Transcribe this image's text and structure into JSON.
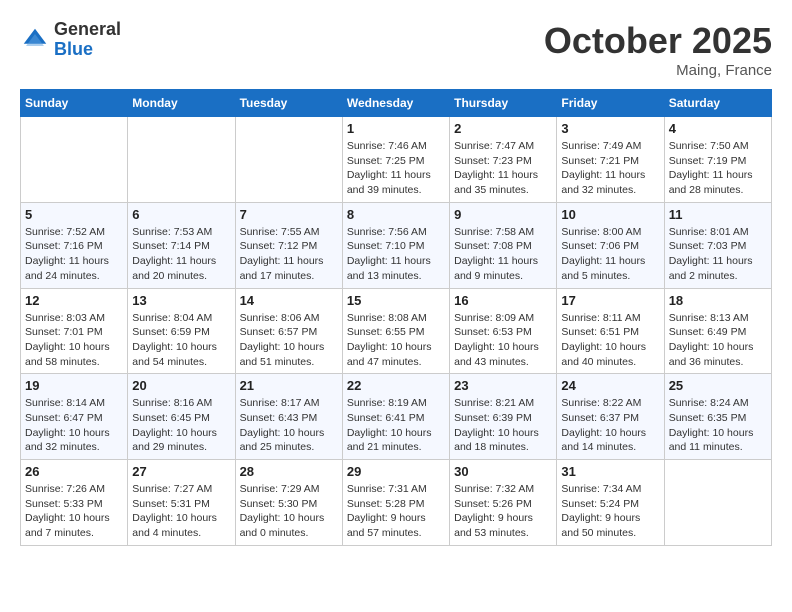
{
  "header": {
    "logo_general": "General",
    "logo_blue": "Blue",
    "month_title": "October 2025",
    "location": "Maing, France"
  },
  "days_of_week": [
    "Sunday",
    "Monday",
    "Tuesday",
    "Wednesday",
    "Thursday",
    "Friday",
    "Saturday"
  ],
  "weeks": [
    [
      {
        "day": "",
        "info": ""
      },
      {
        "day": "",
        "info": ""
      },
      {
        "day": "",
        "info": ""
      },
      {
        "day": "1",
        "sunrise": "Sunrise: 7:46 AM",
        "sunset": "Sunset: 7:25 PM",
        "daylight": "Daylight: 11 hours and 39 minutes."
      },
      {
        "day": "2",
        "sunrise": "Sunrise: 7:47 AM",
        "sunset": "Sunset: 7:23 PM",
        "daylight": "Daylight: 11 hours and 35 minutes."
      },
      {
        "day": "3",
        "sunrise": "Sunrise: 7:49 AM",
        "sunset": "Sunset: 7:21 PM",
        "daylight": "Daylight: 11 hours and 32 minutes."
      },
      {
        "day": "4",
        "sunrise": "Sunrise: 7:50 AM",
        "sunset": "Sunset: 7:19 PM",
        "daylight": "Daylight: 11 hours and 28 minutes."
      }
    ],
    [
      {
        "day": "5",
        "sunrise": "Sunrise: 7:52 AM",
        "sunset": "Sunset: 7:16 PM",
        "daylight": "Daylight: 11 hours and 24 minutes."
      },
      {
        "day": "6",
        "sunrise": "Sunrise: 7:53 AM",
        "sunset": "Sunset: 7:14 PM",
        "daylight": "Daylight: 11 hours and 20 minutes."
      },
      {
        "day": "7",
        "sunrise": "Sunrise: 7:55 AM",
        "sunset": "Sunset: 7:12 PM",
        "daylight": "Daylight: 11 hours and 17 minutes."
      },
      {
        "day": "8",
        "sunrise": "Sunrise: 7:56 AM",
        "sunset": "Sunset: 7:10 PM",
        "daylight": "Daylight: 11 hours and 13 minutes."
      },
      {
        "day": "9",
        "sunrise": "Sunrise: 7:58 AM",
        "sunset": "Sunset: 7:08 PM",
        "daylight": "Daylight: 11 hours and 9 minutes."
      },
      {
        "day": "10",
        "sunrise": "Sunrise: 8:00 AM",
        "sunset": "Sunset: 7:06 PM",
        "daylight": "Daylight: 11 hours and 5 minutes."
      },
      {
        "day": "11",
        "sunrise": "Sunrise: 8:01 AM",
        "sunset": "Sunset: 7:03 PM",
        "daylight": "Daylight: 11 hours and 2 minutes."
      }
    ],
    [
      {
        "day": "12",
        "sunrise": "Sunrise: 8:03 AM",
        "sunset": "Sunset: 7:01 PM",
        "daylight": "Daylight: 10 hours and 58 minutes."
      },
      {
        "day": "13",
        "sunrise": "Sunrise: 8:04 AM",
        "sunset": "Sunset: 6:59 PM",
        "daylight": "Daylight: 10 hours and 54 minutes."
      },
      {
        "day": "14",
        "sunrise": "Sunrise: 8:06 AM",
        "sunset": "Sunset: 6:57 PM",
        "daylight": "Daylight: 10 hours and 51 minutes."
      },
      {
        "day": "15",
        "sunrise": "Sunrise: 8:08 AM",
        "sunset": "Sunset: 6:55 PM",
        "daylight": "Daylight: 10 hours and 47 minutes."
      },
      {
        "day": "16",
        "sunrise": "Sunrise: 8:09 AM",
        "sunset": "Sunset: 6:53 PM",
        "daylight": "Daylight: 10 hours and 43 minutes."
      },
      {
        "day": "17",
        "sunrise": "Sunrise: 8:11 AM",
        "sunset": "Sunset: 6:51 PM",
        "daylight": "Daylight: 10 hours and 40 minutes."
      },
      {
        "day": "18",
        "sunrise": "Sunrise: 8:13 AM",
        "sunset": "Sunset: 6:49 PM",
        "daylight": "Daylight: 10 hours and 36 minutes."
      }
    ],
    [
      {
        "day": "19",
        "sunrise": "Sunrise: 8:14 AM",
        "sunset": "Sunset: 6:47 PM",
        "daylight": "Daylight: 10 hours and 32 minutes."
      },
      {
        "day": "20",
        "sunrise": "Sunrise: 8:16 AM",
        "sunset": "Sunset: 6:45 PM",
        "daylight": "Daylight: 10 hours and 29 minutes."
      },
      {
        "day": "21",
        "sunrise": "Sunrise: 8:17 AM",
        "sunset": "Sunset: 6:43 PM",
        "daylight": "Daylight: 10 hours and 25 minutes."
      },
      {
        "day": "22",
        "sunrise": "Sunrise: 8:19 AM",
        "sunset": "Sunset: 6:41 PM",
        "daylight": "Daylight: 10 hours and 21 minutes."
      },
      {
        "day": "23",
        "sunrise": "Sunrise: 8:21 AM",
        "sunset": "Sunset: 6:39 PM",
        "daylight": "Daylight: 10 hours and 18 minutes."
      },
      {
        "day": "24",
        "sunrise": "Sunrise: 8:22 AM",
        "sunset": "Sunset: 6:37 PM",
        "daylight": "Daylight: 10 hours and 14 minutes."
      },
      {
        "day": "25",
        "sunrise": "Sunrise: 8:24 AM",
        "sunset": "Sunset: 6:35 PM",
        "daylight": "Daylight: 10 hours and 11 minutes."
      }
    ],
    [
      {
        "day": "26",
        "sunrise": "Sunrise: 7:26 AM",
        "sunset": "Sunset: 5:33 PM",
        "daylight": "Daylight: 10 hours and 7 minutes."
      },
      {
        "day": "27",
        "sunrise": "Sunrise: 7:27 AM",
        "sunset": "Sunset: 5:31 PM",
        "daylight": "Daylight: 10 hours and 4 minutes."
      },
      {
        "day": "28",
        "sunrise": "Sunrise: 7:29 AM",
        "sunset": "Sunset: 5:30 PM",
        "daylight": "Daylight: 10 hours and 0 minutes."
      },
      {
        "day": "29",
        "sunrise": "Sunrise: 7:31 AM",
        "sunset": "Sunset: 5:28 PM",
        "daylight": "Daylight: 9 hours and 57 minutes."
      },
      {
        "day": "30",
        "sunrise": "Sunrise: 7:32 AM",
        "sunset": "Sunset: 5:26 PM",
        "daylight": "Daylight: 9 hours and 53 minutes."
      },
      {
        "day": "31",
        "sunrise": "Sunrise: 7:34 AM",
        "sunset": "Sunset: 5:24 PM",
        "daylight": "Daylight: 9 hours and 50 minutes."
      },
      {
        "day": "",
        "info": ""
      }
    ]
  ]
}
